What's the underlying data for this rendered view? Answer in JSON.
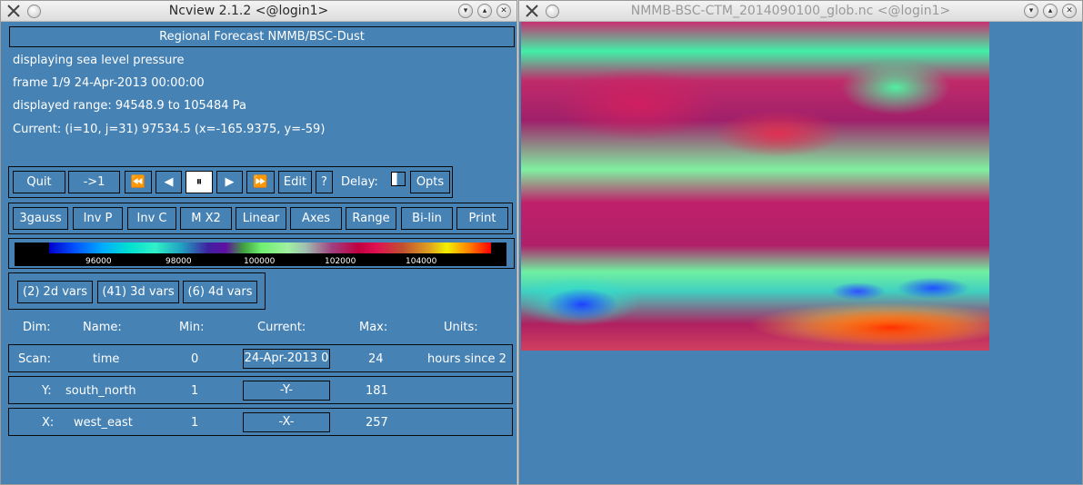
{
  "left_window": {
    "title": "Ncview 2.1.2  <@login1>",
    "header_title": "Regional Forecast NMMB/BSC-Dust",
    "info": [
      "displaying sea level pressure",
      "frame 1/9 24-Apr-2013 00:00:00",
      "displayed range: 94548.9 to 105484 Pa",
      "Current: (i=10, j=31) 97534.5 (x=-165.9375, y=-59)"
    ],
    "controls": {
      "quit": "Quit",
      "goto_first": "->1",
      "rewind_glyph": "⏪",
      "back_glyph": "◀",
      "pause_glyph": "⏸",
      "forward_glyph": "▶",
      "fastforward_glyph": "⏩",
      "edit": "Edit",
      "help": "?",
      "delay_label": "Delay:",
      "opts": "Opts"
    },
    "options": [
      "3gauss",
      "Inv P",
      "Inv C",
      "M X2",
      "Linear",
      "Axes",
      "Range",
      "Bi-lin",
      "Print"
    ],
    "colorbar_ticks": [
      "96000",
      "98000",
      "100000",
      "102000",
      "104000"
    ],
    "var_groups": [
      "(2) 2d vars",
      "(41) 3d vars",
      "(6) 4d vars"
    ],
    "dim_headers": {
      "dim": "Dim:",
      "name": "Name:",
      "min": "Min:",
      "current": "Current:",
      "max": "Max:",
      "units": "Units:"
    },
    "dims": [
      {
        "dim": "Scan:",
        "name": "time",
        "min": "0",
        "current": "24-Apr-2013 0",
        "max": "24",
        "units": "hours since 2"
      },
      {
        "dim": "Y:",
        "name": "south_north",
        "min": "1",
        "current": "-Y-",
        "max": "181",
        "units": ""
      },
      {
        "dim": "X:",
        "name": "west_east",
        "min": "1",
        "current": "-X-",
        "max": "257",
        "units": ""
      }
    ]
  },
  "right_window": {
    "title": "NMMB-BSC-CTM_2014090100_glob.nc <@login1>"
  },
  "colors": {
    "background": "#4682b4",
    "text": "#ffffff",
    "border": "#0a0a0a"
  },
  "icons": {
    "app": "x-logo-icon",
    "menu": "window-menu-icon",
    "minimize": "chevron-down-icon",
    "maximize": "chevron-up-icon",
    "close": "close-icon"
  }
}
